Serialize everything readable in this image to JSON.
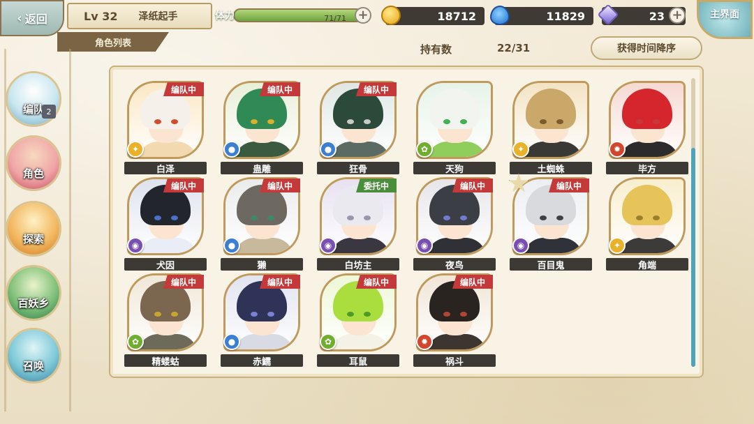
{
  "top": {
    "back_label": "返回",
    "level": "Lv 32",
    "player_name": "泽纸起手",
    "stamina_label": "体力",
    "stamina_value": "71/71",
    "stamina_fraction": 1.0,
    "coins": "18712",
    "spirit": "11829",
    "gems": "23",
    "home_label": "主界面",
    "plus": "+"
  },
  "section_tab": "角色列表",
  "owned_label": "持有数",
  "owned_count": "22/31",
  "sort_label": "获得时间降序",
  "nav": [
    {
      "label": "编队",
      "badge": "2"
    },
    {
      "label": "角色"
    },
    {
      "label": "探索"
    },
    {
      "label": "百妖乡"
    },
    {
      "label": "召唤"
    }
  ],
  "characters": [
    {
      "name": "白泽",
      "status": "编队中",
      "element": "light"
    },
    {
      "name": "蛊雕",
      "status": "编队中",
      "element": "water"
    },
    {
      "name": "狂骨",
      "status": "编队中",
      "element": "water"
    },
    {
      "name": "天狗",
      "status": "",
      "element": "wind"
    },
    {
      "name": "土蜘蛛",
      "status": "",
      "element": "light"
    },
    {
      "name": "毕方",
      "status": "",
      "element": "fire"
    },
    {
      "name": "犬因",
      "status": "编队中",
      "element": "dark"
    },
    {
      "name": "獭",
      "status": "编队中",
      "element": "water"
    },
    {
      "name": "白坊主",
      "status": "委托中",
      "element": "dark"
    },
    {
      "name": "夜鸟",
      "status": "编队中",
      "element": "dark"
    },
    {
      "name": "百目鬼",
      "status": "编队中",
      "element": "dark"
    },
    {
      "name": "角端",
      "status": "",
      "element": "light"
    },
    {
      "name": "精蝼蛄",
      "status": "编队中",
      "element": "wind"
    },
    {
      "name": "赤鱬",
      "status": "编队中",
      "element": "water"
    },
    {
      "name": "耳鼠",
      "status": "编队中",
      "element": "wind"
    },
    {
      "name": "祸斗",
      "status": "编队中",
      "element": "fire"
    }
  ],
  "element_colors": {
    "light": "#e9b22a",
    "water": "#3a7fd0",
    "wind": "#6fae2e",
    "fire": "#d2462e",
    "dark": "#7a4fb3"
  }
}
